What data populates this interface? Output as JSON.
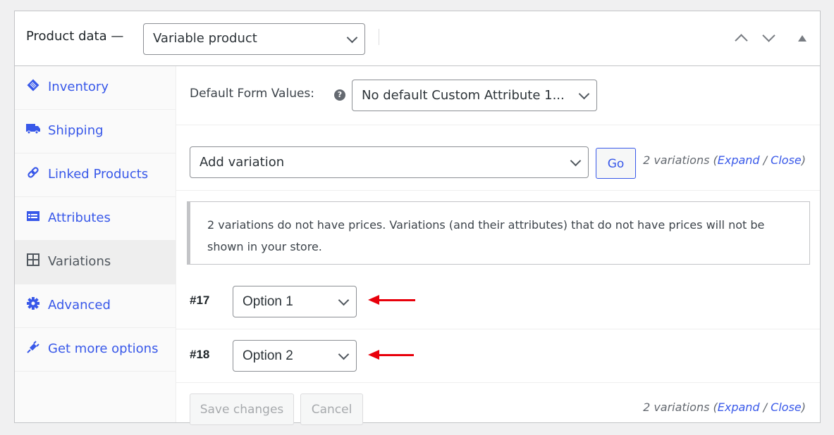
{
  "header": {
    "title": "Product data —",
    "product_type": "Variable product",
    "icons": [
      "chevron-up-icon",
      "chevron-down-icon",
      "collapse-triangle-icon"
    ]
  },
  "sidebar": {
    "items": [
      {
        "label": "Inventory",
        "icon": "inventory-tag-icon",
        "active": false
      },
      {
        "label": "Shipping",
        "icon": "truck-icon",
        "active": false
      },
      {
        "label": "Linked Products",
        "icon": "link-icon",
        "active": false
      },
      {
        "label": "Attributes",
        "icon": "list-table-icon",
        "active": false
      },
      {
        "label": "Variations",
        "icon": "grid-icon",
        "active": true
      },
      {
        "label": "Advanced",
        "icon": "gear-icon",
        "active": false
      },
      {
        "label": "Get more options",
        "icon": "plugin-icon",
        "active": false
      }
    ]
  },
  "main": {
    "default_form_values_label": "Default Form Values:",
    "help_icon": "?",
    "default_select_value": "No default Custom Attribute 1...",
    "add_variation_select": "Add variation",
    "go_label": "Go",
    "count_text": "2 variations (",
    "expand_label": "Expand",
    "divider": " / ",
    "close_label": "Close",
    "close_paren": ")",
    "notice": "2 variations do not have prices. Variations (and their attributes) that do not have prices will not be shown in your store.",
    "variations": [
      {
        "id": "#17",
        "value": "Option 1"
      },
      {
        "id": "#18",
        "value": "Option 2"
      }
    ],
    "save_label": "Save changes",
    "cancel_label": "Cancel"
  },
  "colors": {
    "accent": "#3858e9",
    "annotation_arrow": "#e8000b",
    "border": "#c3c4c7"
  }
}
